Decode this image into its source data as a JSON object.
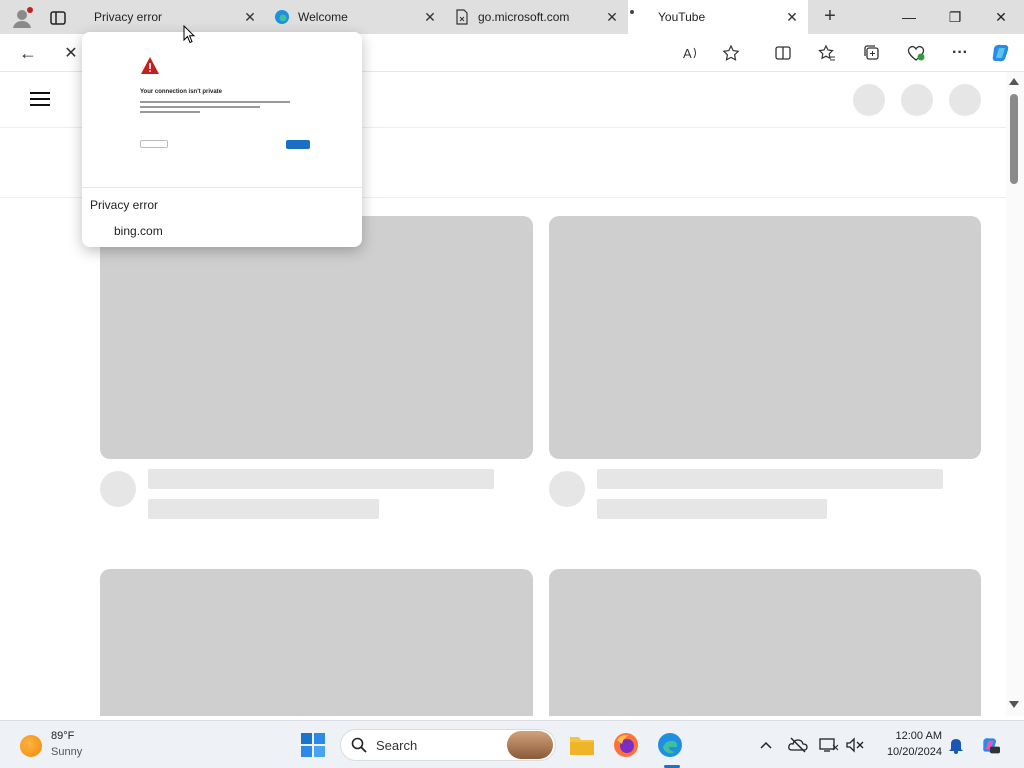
{
  "browser": {
    "tabs": [
      {
        "title": "Privacy error",
        "close": "✕"
      },
      {
        "title": "Welcome",
        "close": "✕"
      },
      {
        "title": "go.microsoft.com",
        "close": "✕"
      },
      {
        "title": "YouTube",
        "close": "✕"
      }
    ],
    "new_tab": "+",
    "window_buttons": {
      "minimize": "—",
      "restore": "❐",
      "close": "✕"
    },
    "toolbar": {
      "back": "←",
      "stop": "✕",
      "more": "···"
    }
  },
  "hover_card": {
    "title": "Privacy error",
    "url": "bing.com",
    "preview": {
      "heading": "Your connection isn't private"
    }
  },
  "taskbar": {
    "weather": {
      "temp": "89°F",
      "desc": "Sunny"
    },
    "search": {
      "label": "Search"
    },
    "clock": {
      "time": "12:00 AM",
      "date": "10/20/2024"
    }
  },
  "colors": {
    "accent": "#1a73d1",
    "skeleton": "#cfcfcf",
    "skeleton_light": "#e6e6e6"
  }
}
